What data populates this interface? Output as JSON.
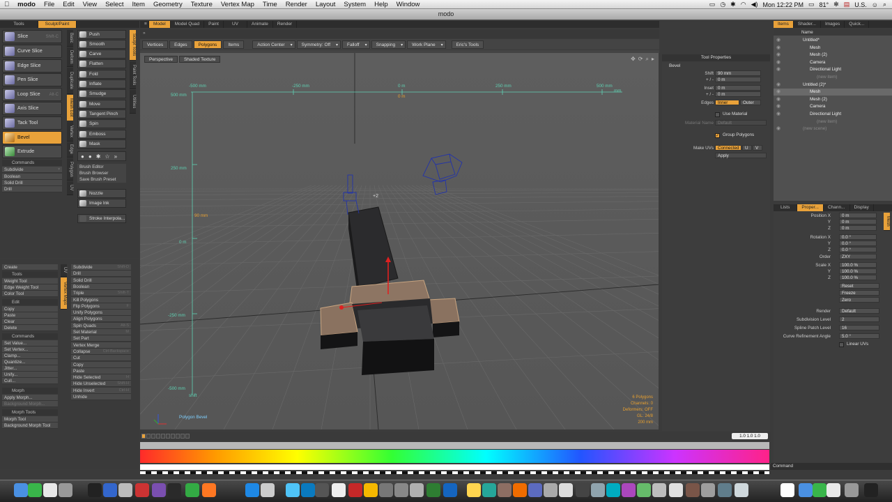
{
  "menubar": {
    "app": "modo",
    "items": [
      "File",
      "Edit",
      "View",
      "Select",
      "Item",
      "Geometry",
      "Texture",
      "Vertex Map",
      "Time",
      "Render",
      "Layout",
      "System",
      "Help",
      "Window"
    ],
    "clock": "Mon 12:22 PM",
    "temp": "81°",
    "locale": "U.S."
  },
  "window": {
    "title": "modo"
  },
  "left": {
    "tabs": [
      "Tools",
      "Sculpt/Paint"
    ],
    "vtabs": [
      "Basic",
      "Deform",
      "Duplicate",
      "Mesh Edit",
      "Vertex",
      "Edge",
      "Polygon",
      "UV"
    ],
    "tools": [
      {
        "label": "Slice",
        "shortcut": "Shift-C"
      },
      {
        "label": "Curve Slice",
        "shortcut": ""
      },
      {
        "label": "Edge Slice",
        "shortcut": ""
      },
      {
        "label": "Pen Slice",
        "shortcut": ""
      },
      {
        "label": "Loop Slice",
        "shortcut": "Alt-C"
      },
      {
        "label": "Axis Slice",
        "shortcut": ""
      },
      {
        "label": "Tack Tool",
        "shortcut": ""
      },
      {
        "label": "Bevel",
        "shortcut": ""
      },
      {
        "label": "Extrude",
        "shortcut": ""
      }
    ],
    "commands_header": "Commands",
    "commands": [
      "Subdivide",
      "Boolean",
      "Solid Drill",
      "Drill"
    ],
    "sculpt": [
      "Push",
      "Smooth",
      "Carve",
      "Flatten",
      "Fold",
      "Inflate",
      "Smudge",
      "Move",
      "Tangent Pinch",
      "Spin",
      "Emboss",
      "Mask"
    ],
    "sculpt_vtabs": [
      "Sculpt Tools",
      "Paint Tools",
      "Utilities"
    ],
    "brush": [
      "Brush Editor",
      "Brush Browser",
      "Save Brush Preset"
    ],
    "nozzle": "Nozzle",
    "image_ink": "Image Ink",
    "stroke": "Stroke Interpola..."
  },
  "lower_left": {
    "create": "Create",
    "tools_h": "Tools",
    "tools": [
      "Weight Tool",
      "Edge Weight Tool",
      "Color Tool"
    ],
    "edit_h": "Edit",
    "edit": [
      "Copy",
      "Paste",
      "Clear",
      "Delete"
    ],
    "commands_h": "Commands",
    "commands": [
      "Set Value...",
      "Set Vertex...",
      "Clamp...",
      "Quantize...",
      "Jitter...",
      "Unify...",
      "Cull..."
    ],
    "morph_h": "Morph",
    "morph": [
      "Apply Morph...",
      "Background Morph..."
    ],
    "morph_tools_h": "Morph Tools",
    "morph_tools": [
      "Morph Tool",
      "Background Morph Tool"
    ],
    "vtabs": [
      "UV",
      "Vertex Maps"
    ]
  },
  "mesh_cmds": [
    {
      "label": "Subdivide",
      "sc": "Shift-D"
    },
    {
      "label": "Drill",
      "sc": ""
    },
    {
      "label": "Solid Drill",
      "sc": ""
    },
    {
      "label": "Boolean",
      "sc": ""
    },
    {
      "label": "Triple",
      "sc": "Shift-T"
    },
    {
      "label": "Kill Polygons",
      "sc": ""
    },
    {
      "label": "Flip Polygons",
      "sc": "F"
    },
    {
      "label": "Unify Polygons",
      "sc": ""
    },
    {
      "label": "Align Polygons",
      "sc": ""
    },
    {
      "label": "Spin Quads",
      "sc": "Alt-S"
    },
    {
      "label": "Set Material",
      "sc": "M"
    },
    {
      "label": "Set Part",
      "sc": ""
    },
    {
      "label": "Vertex Merge",
      "sc": ""
    },
    {
      "label": "Collapse",
      "sc": "Ctrl-Backspace"
    },
    {
      "label": "Cut",
      "sc": ""
    },
    {
      "label": "Copy",
      "sc": ""
    },
    {
      "label": "Paste",
      "sc": ""
    },
    {
      "label": "Hide Selected",
      "sc": "H"
    },
    {
      "label": "Hide Unselected",
      "sc": "Shift-H"
    },
    {
      "label": "Hide Invert",
      "sc": "Ctrl-H"
    },
    {
      "label": "Unhide",
      "sc": ""
    }
  ],
  "center_tabs": [
    "Model",
    "Model Quad",
    "Paint",
    "UV",
    "Animate",
    "Render"
  ],
  "toolbar": [
    {
      "label": "Vertices",
      "on": false,
      "dd": false
    },
    {
      "label": "Edges",
      "on": false,
      "dd": false
    },
    {
      "label": "Polygons",
      "on": true,
      "dd": false
    },
    {
      "label": "Items",
      "on": false,
      "dd": false
    },
    {
      "label": "Action Center",
      "on": false,
      "dd": true
    },
    {
      "label": "Symmetry: Off",
      "on": false,
      "dd": true
    },
    {
      "label": "Falloff",
      "on": false,
      "dd": true
    },
    {
      "label": "Snapping",
      "on": false,
      "dd": true
    },
    {
      "label": "Work Plane",
      "on": false,
      "dd": true
    },
    {
      "label": "Eric's Tools",
      "on": false,
      "dd": false
    }
  ],
  "viewport": {
    "perspective": "Perspective",
    "shading": "Shaded Texture",
    "ruler_top": [
      "-500 mm",
      "-250 mm",
      "0 m",
      "250 mm",
      "500 mm"
    ],
    "ruler_top_unit": "0 m",
    "ruler_left": [
      "500 mm",
      "250 mm",
      "0 m",
      "-250 mm",
      "-500 mm"
    ],
    "ruler_left_unit": "0 m",
    "ruler_x_label": "mm",
    "ruler_y_label": "shift",
    "bevel_shift": "90 mm",
    "tool_label": "Polygon Bevel",
    "stats": [
      "6 Polygons",
      "Channels: 0",
      "Deformers: OFF",
      "GL: 24/8",
      "200 mm"
    ]
  },
  "tool_props": {
    "title": "Tool Properties",
    "tool": "Bevel",
    "shift_label": "Shift",
    "shift": "90 mm",
    "shift_pm": "0 m",
    "inset_label": "Inset",
    "inset": "0 m",
    "inset_pm": "0 m",
    "pm_label": "+ / -",
    "edges_label": "Edges",
    "edges_inner": "Inner",
    "edges_outer": "Outer",
    "use_material": "Use Material",
    "material_label": "Material Name",
    "material": "Default",
    "group_polygons": "Group Polygons",
    "make_uvs_label": "Make UVs",
    "make_uvs": "Connected",
    "make_uvs_u": "U",
    "make_uvs_v": "V",
    "apply": "Apply"
  },
  "items": {
    "tabs": [
      "Items",
      "Shader...",
      "Images",
      "Quick..."
    ],
    "col": "Name",
    "tree": [
      {
        "label": "Untitled*",
        "indent": 0
      },
      {
        "label": "Mesh",
        "indent": 1
      },
      {
        "label": "Mesh (2)",
        "indent": 1
      },
      {
        "label": "Camera",
        "indent": 1
      },
      {
        "label": "Directional Light",
        "indent": 1
      },
      {
        "label": "(new item)",
        "indent": 2
      },
      {
        "label": "Untitled (2)*",
        "indent": 0
      },
      {
        "label": "Mesh",
        "indent": 1
      },
      {
        "label": "Mesh (2)",
        "indent": 1
      },
      {
        "label": "Camera",
        "indent": 1
      },
      {
        "label": "Directional Light",
        "indent": 1
      },
      {
        "label": "(new item)",
        "indent": 2
      },
      {
        "label": "(new scene)",
        "indent": 0
      }
    ]
  },
  "props": {
    "tabs": [
      "Lists",
      "Proper...",
      "Chann...",
      "Display"
    ],
    "pos": [
      "0 m",
      "0 m",
      "0 m"
    ],
    "rot": [
      "0.0 °",
      "0.0 °",
      "0.0 °"
    ],
    "order": "ZXY",
    "scale": [
      "100.0 %",
      "100.0 %",
      "100.0 %"
    ],
    "position_label": "Position X",
    "rotation_label": "Rotation X",
    "scale_label": "Scale X",
    "order_label": "Order",
    "reset": "Reset",
    "freeze": "Freeze",
    "zero": "Zero",
    "render_label": "Render",
    "render": "Default",
    "subdiv_label": "Subdivision Level",
    "subdiv": "2",
    "spline_label": "Spline Patch Level",
    "spline": "16",
    "curve_label": "Curve Refinement Angle",
    "curve": "5.0 °",
    "linear_uvs": "Linear UVs",
    "mesh_tab": "Mesh"
  },
  "timeline": {
    "range": "1.0 1.0 1.0"
  },
  "command": {
    "label": "Command"
  },
  "colors": {
    "accent": "#e9a23a",
    "panel": "#3f3f3f",
    "viewport": "#595959"
  }
}
